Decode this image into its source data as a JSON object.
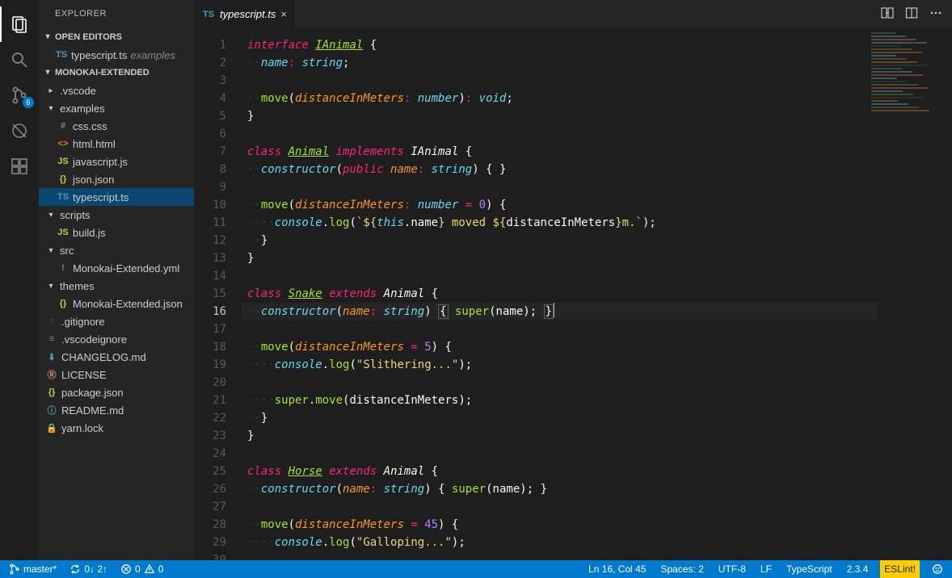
{
  "sidebar": {
    "title": "EXPLORER",
    "open_editors_label": "OPEN EDITORS",
    "open_editor": {
      "filename": "typescript.ts",
      "dir": "examples"
    },
    "workspace_label": "MONOKAI-EXTENDED",
    "scm_badge": "6",
    "tree": [
      {
        "name": ".vscode",
        "type": "folder",
        "depth": 0,
        "open": false
      },
      {
        "name": "examples",
        "type": "folder",
        "depth": 0,
        "open": true
      },
      {
        "name": "css.css",
        "type": "file",
        "icon": "css",
        "sym": "#",
        "depth": 1
      },
      {
        "name": "html.html",
        "type": "file",
        "icon": "html",
        "sym": "<>",
        "depth": 1
      },
      {
        "name": "javascript.js",
        "type": "file",
        "icon": "js",
        "sym": "JS",
        "depth": 1
      },
      {
        "name": "json.json",
        "type": "file",
        "icon": "json",
        "sym": "{}",
        "depth": 1
      },
      {
        "name": "typescript.ts",
        "type": "file",
        "icon": "ts",
        "sym": "TS",
        "depth": 1,
        "selected": true
      },
      {
        "name": "scripts",
        "type": "folder",
        "depth": 0,
        "open": true
      },
      {
        "name": "build.js",
        "type": "file",
        "icon": "js",
        "sym": "JS",
        "depth": 1
      },
      {
        "name": "src",
        "type": "folder",
        "depth": 0,
        "open": true
      },
      {
        "name": "Monokai-Extended.yml",
        "type": "file",
        "icon": "yml",
        "sym": "!",
        "depth": 1
      },
      {
        "name": "themes",
        "type": "folder",
        "depth": 0,
        "open": true
      },
      {
        "name": "Monokai-Extended.json",
        "type": "file",
        "icon": "json",
        "sym": "{}",
        "depth": 1
      },
      {
        "name": ".gitignore",
        "type": "file",
        "icon": "git",
        "sym": "◌",
        "depth": 0
      },
      {
        "name": ".vscodeignore",
        "type": "file",
        "icon": "ignore",
        "sym": "≡",
        "depth": 0
      },
      {
        "name": "CHANGELOG.md",
        "type": "file",
        "icon": "md",
        "sym": "⬇",
        "depth": 0
      },
      {
        "name": "LICENSE",
        "type": "file",
        "icon": "lic",
        "sym": "Ⓡ",
        "depth": 0
      },
      {
        "name": "package.json",
        "type": "file",
        "icon": "json",
        "sym": "{}",
        "depth": 0
      },
      {
        "name": "README.md",
        "type": "file",
        "icon": "info",
        "sym": "ⓘ",
        "depth": 0
      },
      {
        "name": "yarn.lock",
        "type": "file",
        "icon": "lock",
        "sym": "🔒",
        "depth": 0
      }
    ]
  },
  "tab": {
    "filename": "typescript.ts"
  },
  "cursor": {
    "line": 16,
    "col": 45
  },
  "code_lines": 30,
  "code": {
    "1": [
      [
        "kw",
        "interface"
      ],
      [
        "sp",
        " "
      ],
      [
        "type",
        "IAnimal"
      ],
      [
        "sp",
        " "
      ],
      [
        "pn",
        "{"
      ]
    ],
    "2": [
      [
        "inv",
        "··"
      ],
      [
        "id",
        "name"
      ],
      [
        "op",
        ":"
      ],
      [
        "sp",
        " "
      ],
      [
        "id",
        "string"
      ],
      [
        "pn",
        ";"
      ]
    ],
    "3": [],
    "4": [
      [
        "inv",
        "··"
      ],
      [
        "fn",
        "move"
      ],
      [
        "pn",
        "("
      ],
      [
        "param",
        "distanceInMeters"
      ],
      [
        "op",
        ":"
      ],
      [
        "sp",
        " "
      ],
      [
        "id",
        "number"
      ],
      [
        "pn",
        ")"
      ],
      [
        "op",
        ":"
      ],
      [
        "sp",
        " "
      ],
      [
        "id",
        "void"
      ],
      [
        "pn",
        ";"
      ]
    ],
    "5": [
      [
        "pn",
        "}"
      ]
    ],
    "6": [],
    "7": [
      [
        "kw",
        "class"
      ],
      [
        "sp",
        " "
      ],
      [
        "type",
        "Animal"
      ],
      [
        "sp",
        " "
      ],
      [
        "kw",
        "implements"
      ],
      [
        "sp",
        " "
      ],
      [
        "ivar",
        "IAnimal"
      ],
      [
        "sp",
        " "
      ],
      [
        "pn",
        "{"
      ]
    ],
    "8": [
      [
        "inv",
        "··"
      ],
      [
        "id",
        "constructor"
      ],
      [
        "pn",
        "("
      ],
      [
        "kw",
        "public"
      ],
      [
        "sp",
        " "
      ],
      [
        "param",
        "name"
      ],
      [
        "op",
        ":"
      ],
      [
        "sp",
        " "
      ],
      [
        "id",
        "string"
      ],
      [
        "pn",
        ")"
      ],
      [
        "sp",
        " "
      ],
      [
        "pn",
        "{"
      ],
      [
        "sp",
        " "
      ],
      [
        "pn",
        "}"
      ]
    ],
    "9": [],
    "10": [
      [
        "inv",
        "··"
      ],
      [
        "fn",
        "move"
      ],
      [
        "pn",
        "("
      ],
      [
        "param",
        "distanceInMeters"
      ],
      [
        "op",
        ":"
      ],
      [
        "sp",
        " "
      ],
      [
        "id",
        "number"
      ],
      [
        "sp",
        " "
      ],
      [
        "op",
        "="
      ],
      [
        "sp",
        " "
      ],
      [
        "num",
        "0"
      ],
      [
        "pn",
        ")"
      ],
      [
        "sp",
        " "
      ],
      [
        "pn",
        "{"
      ]
    ],
    "11": [
      [
        "inv",
        "····"
      ],
      [
        "obj",
        "console"
      ],
      [
        "pn",
        "."
      ],
      [
        "fn",
        "log"
      ],
      [
        "pn",
        "("
      ],
      [
        "str",
        "`${"
      ],
      [
        "obj",
        "this"
      ],
      [
        "pn",
        "."
      ],
      [
        "mem",
        "name"
      ],
      [
        "str",
        "} moved ${"
      ],
      [
        "mem",
        "distanceInMeters"
      ],
      [
        "str",
        "}m.`"
      ],
      [
        "pn",
        ")"
      ],
      [
        "pn",
        ";"
      ]
    ],
    "12": [
      [
        "inv",
        "··"
      ],
      [
        "pn",
        "}"
      ]
    ],
    "13": [
      [
        "pn",
        "}"
      ]
    ],
    "14": [],
    "15": [
      [
        "kw",
        "class"
      ],
      [
        "sp",
        " "
      ],
      [
        "type",
        "Snake"
      ],
      [
        "sp",
        " "
      ],
      [
        "kw",
        "extends"
      ],
      [
        "sp",
        " "
      ],
      [
        "ivar",
        "Animal"
      ],
      [
        "sp",
        " "
      ],
      [
        "pn",
        "{"
      ]
    ],
    "16": [
      [
        "inv",
        "··"
      ],
      [
        "id",
        "constructor"
      ],
      [
        "pn",
        "("
      ],
      [
        "param",
        "name"
      ],
      [
        "op",
        ":"
      ],
      [
        "sp",
        " "
      ],
      [
        "id",
        "string"
      ],
      [
        "pn",
        ")"
      ],
      [
        "sp",
        " "
      ],
      [
        "boxch",
        "{"
      ],
      [
        "sp",
        " "
      ],
      [
        "fn",
        "super"
      ],
      [
        "pn",
        "("
      ],
      [
        "mem",
        "name"
      ],
      [
        "pn",
        ")"
      ],
      [
        "pn",
        ";"
      ],
      [
        "sp",
        " "
      ],
      [
        "boxch",
        "}"
      ],
      [
        "cursor",
        ""
      ]
    ],
    "17": [],
    "18": [
      [
        "inv",
        "··"
      ],
      [
        "fn",
        "move"
      ],
      [
        "pn",
        "("
      ],
      [
        "param",
        "distanceInMeters"
      ],
      [
        "sp",
        " "
      ],
      [
        "op",
        "="
      ],
      [
        "sp",
        " "
      ],
      [
        "num",
        "5"
      ],
      [
        "pn",
        ")"
      ],
      [
        "sp",
        " "
      ],
      [
        "pn",
        "{"
      ]
    ],
    "19": [
      [
        "inv",
        "····"
      ],
      [
        "obj",
        "console"
      ],
      [
        "pn",
        "."
      ],
      [
        "fn",
        "log"
      ],
      [
        "pn",
        "("
      ],
      [
        "str",
        "\"Slithering...\""
      ],
      [
        "pn",
        ")"
      ],
      [
        "pn",
        ";"
      ]
    ],
    "20": [],
    "21": [
      [
        "inv",
        "····"
      ],
      [
        "fn",
        "super"
      ],
      [
        "pn",
        "."
      ],
      [
        "fn",
        "move"
      ],
      [
        "pn",
        "("
      ],
      [
        "mem",
        "distanceInMeters"
      ],
      [
        "pn",
        ")"
      ],
      [
        "pn",
        ";"
      ]
    ],
    "22": [
      [
        "inv",
        "··"
      ],
      [
        "pn",
        "}"
      ]
    ],
    "23": [
      [
        "pn",
        "}"
      ]
    ],
    "24": [],
    "25": [
      [
        "kw",
        "class"
      ],
      [
        "sp",
        " "
      ],
      [
        "type",
        "Horse"
      ],
      [
        "sp",
        " "
      ],
      [
        "kw",
        "extends"
      ],
      [
        "sp",
        " "
      ],
      [
        "ivar",
        "Animal"
      ],
      [
        "sp",
        " "
      ],
      [
        "pn",
        "{"
      ]
    ],
    "26": [
      [
        "inv",
        "··"
      ],
      [
        "id",
        "constructor"
      ],
      [
        "pn",
        "("
      ],
      [
        "param",
        "name"
      ],
      [
        "op",
        ":"
      ],
      [
        "sp",
        " "
      ],
      [
        "id",
        "string"
      ],
      [
        "pn",
        ")"
      ],
      [
        "sp",
        " "
      ],
      [
        "pn",
        "{"
      ],
      [
        "sp",
        " "
      ],
      [
        "fn",
        "super"
      ],
      [
        "pn",
        "("
      ],
      [
        "mem",
        "name"
      ],
      [
        "pn",
        ")"
      ],
      [
        "pn",
        ";"
      ],
      [
        "sp",
        " "
      ],
      [
        "pn",
        "}"
      ]
    ],
    "27": [],
    "28": [
      [
        "inv",
        "··"
      ],
      [
        "fn",
        "move"
      ],
      [
        "pn",
        "("
      ],
      [
        "param",
        "distanceInMeters"
      ],
      [
        "sp",
        " "
      ],
      [
        "op",
        "="
      ],
      [
        "sp",
        " "
      ],
      [
        "num",
        "45"
      ],
      [
        "pn",
        ")"
      ],
      [
        "sp",
        " "
      ],
      [
        "pn",
        "{"
      ]
    ],
    "29": [
      [
        "inv",
        "····"
      ],
      [
        "obj",
        "console"
      ],
      [
        "pn",
        "."
      ],
      [
        "fn",
        "log"
      ],
      [
        "pn",
        "("
      ],
      [
        "str",
        "\"Galloping...\""
      ],
      [
        "pn",
        ")"
      ],
      [
        "pn",
        ";"
      ]
    ],
    "30": []
  },
  "status": {
    "branch": "master*",
    "sync": "0↓ 2↑",
    "errors": "0",
    "warnings": "0",
    "lncol": "Ln 16, Col 45",
    "spaces": "Spaces: 2",
    "encoding": "UTF-8",
    "eol": "LF",
    "lang": "TypeScript",
    "ver": "2.3.4",
    "eslint": "ESLint!"
  }
}
